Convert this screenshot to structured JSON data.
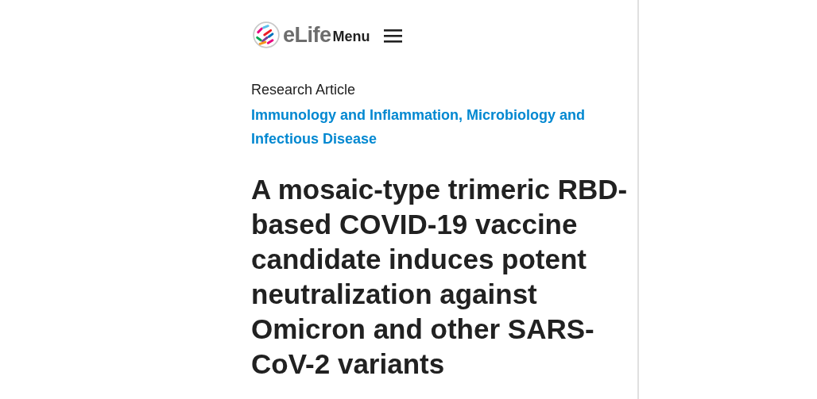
{
  "header": {
    "logo_text": "eLife",
    "menu_label": "Menu"
  },
  "article": {
    "type": "Research Article",
    "subjects": "Immunology and Inflammation, Microbiology and Infectious Disease",
    "title": "A mosaic-type trimeric RBD-based COVID-19 vaccine candidate induces potent neutralization against Omicron and other SARS-CoV-2 variants"
  }
}
